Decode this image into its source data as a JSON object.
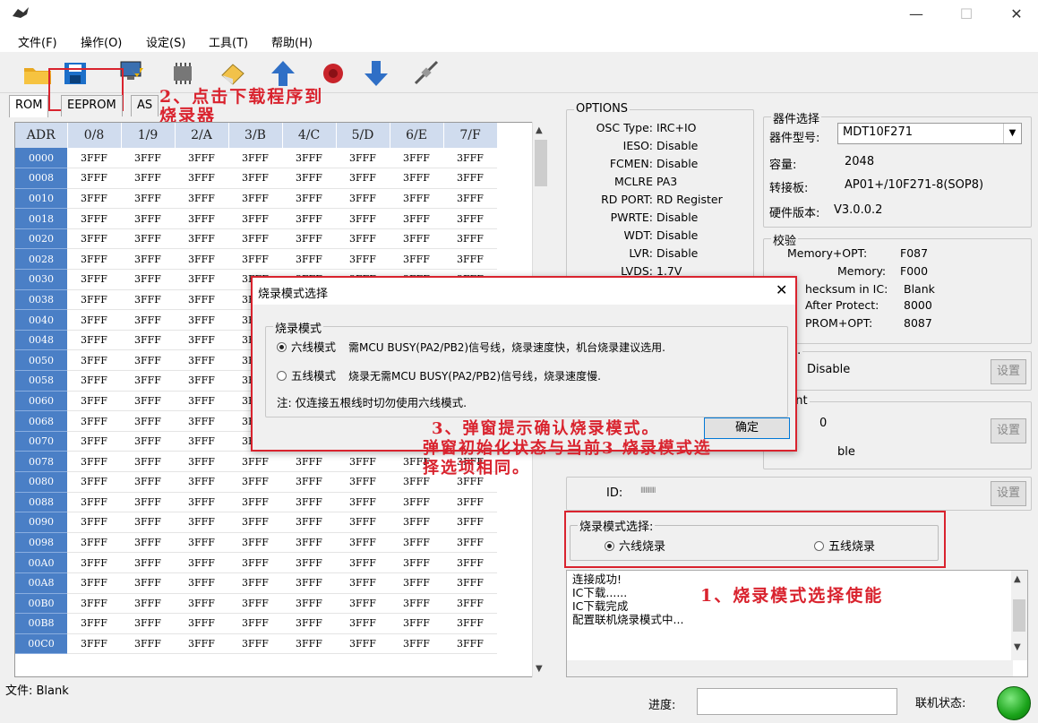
{
  "menu": [
    "文件(F)",
    "操作(O)",
    "设定(S)",
    "工具(T)",
    "帮助(H)"
  ],
  "tabs": {
    "rom": "ROM",
    "eeprom": "EEPROM",
    "asm": "AS"
  },
  "table": {
    "headers": [
      "ADR",
      "0/8",
      "1/9",
      "2/A",
      "3/B",
      "4/C",
      "5/D",
      "6/E",
      "7/F"
    ],
    "addresses": [
      "0000",
      "0008",
      "0010",
      "0018",
      "0020",
      "0028",
      "0030",
      "0038",
      "0040",
      "0048",
      "0050",
      "0058",
      "0060",
      "0068",
      "0070",
      "0078",
      "0080",
      "0088",
      "0090",
      "0098",
      "00A0",
      "00A8",
      "00B0",
      "00B8",
      "00C0"
    ],
    "value": "3FFF"
  },
  "options": {
    "title": "OPTIONS",
    "rows": [
      {
        "k": "OSC Type:",
        "v": "IRC+IO"
      },
      {
        "k": "IESO:",
        "v": "Disable"
      },
      {
        "k": "FCMEN:",
        "v": "Disable"
      },
      {
        "k": "MCLRE",
        "v": "PA3"
      },
      {
        "k": "RD PORT:",
        "v": "RD Register"
      },
      {
        "k": "PWRTE:",
        "v": "Disable"
      },
      {
        "k": "WDT:",
        "v": "Disable"
      },
      {
        "k": "LVR:",
        "v": "Disable"
      },
      {
        "k": "LVDS:",
        "v": "1.7V"
      }
    ]
  },
  "device": {
    "title": "器件选择",
    "model_label": "器件型号:",
    "model": "MDT10F271",
    "cap_label": "容量:",
    "cap": "2048",
    "adapter_label": "转接板:",
    "adapter": "AP01+/10F271-8(SOP8)",
    "hw_label": "硬件版本:",
    "hw": "V3.0.0.2"
  },
  "checksum": {
    "title": "校验",
    "mem_opt": "Memory+OPT:",
    "mem_opt_v": "F087",
    "mem": "Memory:",
    "mem_v": "F000",
    "chk": "hecksum in IC:",
    "chk_v": "Blank",
    "after": "After Protect:",
    "after_v": "8000",
    "prom": "PROM+OPT:",
    "prom_v": "8087"
  },
  "serial": {
    "title": "l NO.",
    "value": "Disable",
    "set": "设置"
  },
  "count": {
    "title": "Count",
    "value": "0",
    "enable": "ble",
    "set": "设置"
  },
  "idbox": {
    "label": "ID:",
    "value": "IIIIIIIIII",
    "set": "设置"
  },
  "mode": {
    "title": "烧录模式选择:",
    "six": "六线烧录",
    "five": "五线烧录"
  },
  "log": [
    "连接成功!",
    "IC下载......",
    "IC下载完成",
    "配置联机烧录模式中..."
  ],
  "status": {
    "file": "文件: Blank",
    "progress": "进度:",
    "conn": "联机状态:"
  },
  "dialog": {
    "title": "烧录模式选择",
    "group": "烧录模式",
    "six_label": "六线模式",
    "six_desc": "需MCU BUSY(PA2/PB2)信号线，烧录速度快，机台烧录建议选用.",
    "five_label": "五线模式",
    "five_desc": "烧录无需MCU BUSY(PA2/PB2)信号线，烧录速度慢.",
    "note": "注: 仅连接五根线时切勿使用六线模式.",
    "ok": "确定"
  },
  "annotations": {
    "a1": "1、烧录模式选择使能",
    "a2a": "2、点击下载程序到",
    "a2b": "烧录器",
    "a3a": "3、弹窗提示确认烧录模式。",
    "a3b": "弹窗初始化状态与当前3 烧录模式选",
    "a3c": "择选项相同。"
  },
  "colors": {
    "accent": "#d9232e",
    "adr_bg": "#4a7fc6",
    "led": "#1aa31a"
  }
}
